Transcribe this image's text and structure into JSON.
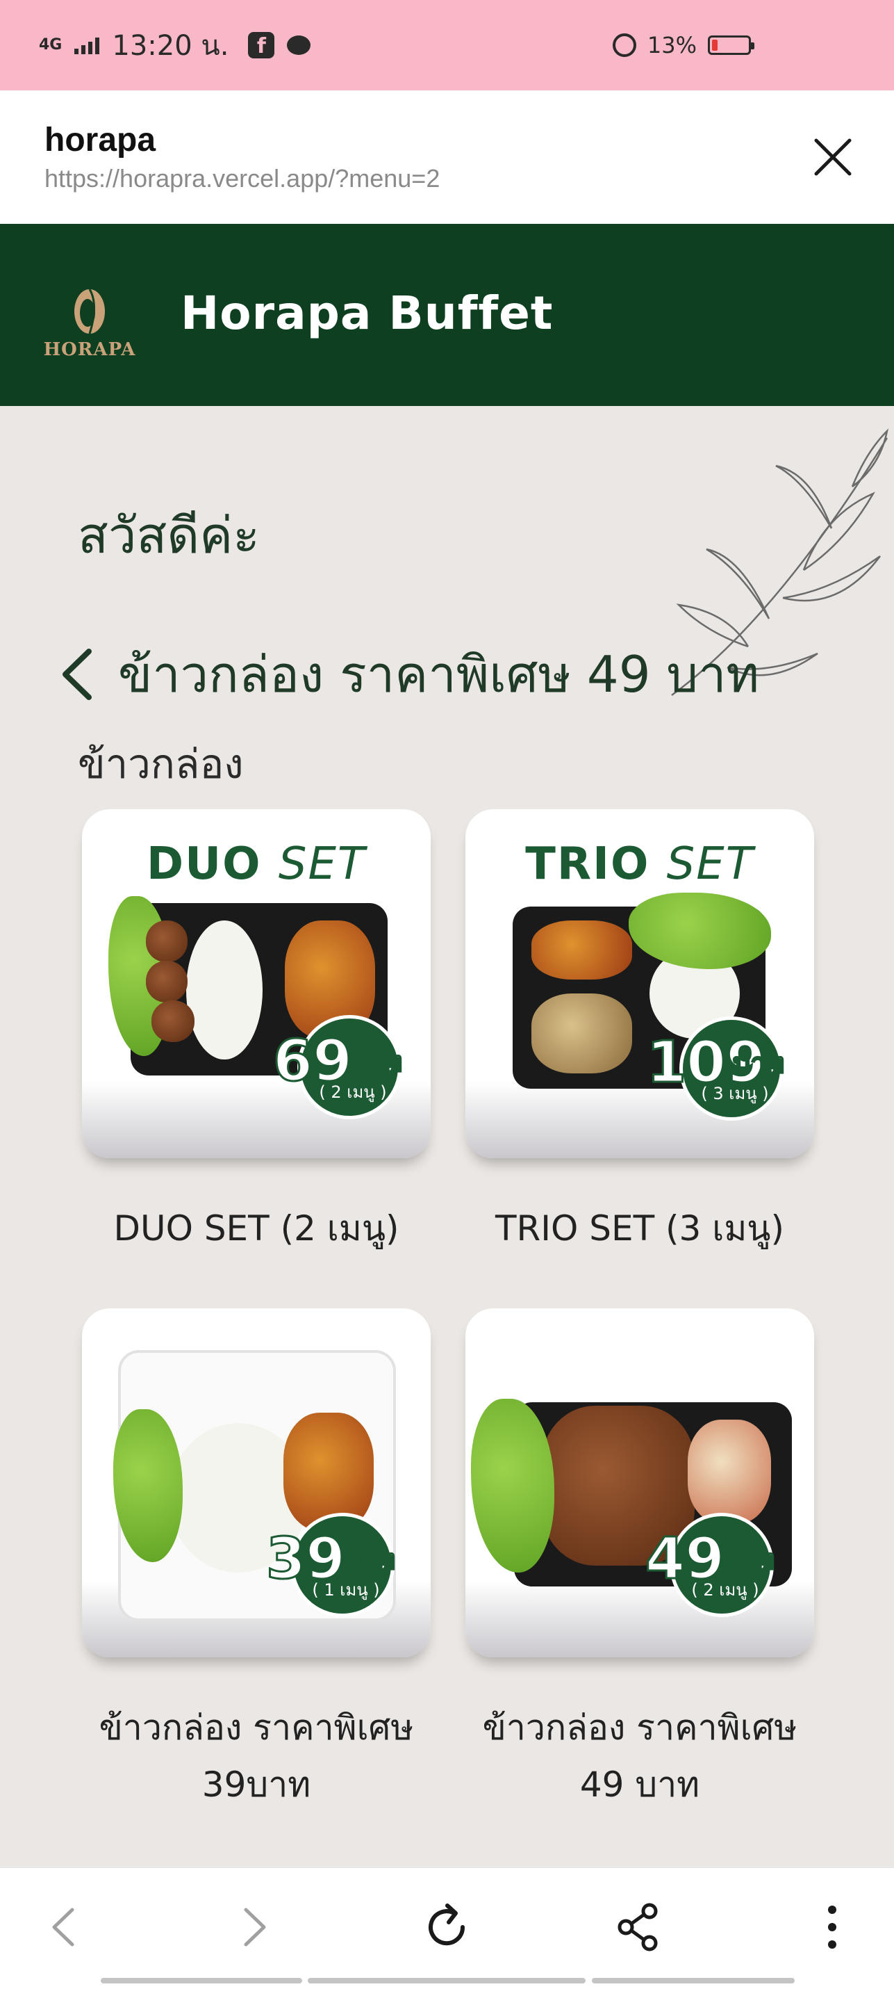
{
  "status_bar": {
    "network": "4G",
    "time": "13:20 น.",
    "battery": "13%",
    "facebook_glyph": "f"
  },
  "browser": {
    "title": "horapa",
    "url": "https://horapra.vercel.app/?menu=2"
  },
  "header": {
    "logo_text": "HORAPA",
    "title": "Horapa Buffet",
    "background": "#0e3f20"
  },
  "main": {
    "greeting": "สวัสดีค่ะ",
    "category_title": "ข้าวกล่อง ราคาพิเศษ 49 บาท",
    "section_label": "ข้าวกล่อง"
  },
  "products": [
    {
      "name": "DUO SET (2 เมนู)",
      "image_title_bold": "DUO",
      "image_title_light": "SET",
      "price": "69",
      "unit": "บาท",
      "menu_count": "( 2 เมนู )"
    },
    {
      "name": "TRIO SET (3 เมนู)",
      "image_title_bold": "TRIO",
      "image_title_light": "SET",
      "price": "109",
      "unit": "บาท",
      "menu_count": "( 3 เมนู )"
    },
    {
      "name_line1": "ข้าวกล่อง ราคาพิเศษ",
      "name_line2": "39บาท",
      "price": "39",
      "unit": "บาท",
      "menu_count": "( 1 เมนู )"
    },
    {
      "name_line1": "ข้าวกล่อง ราคาพิเศษ",
      "name_line2": "49 บาท",
      "price": "49",
      "unit": "บาท",
      "menu_count": "( 2 เมนู )"
    }
  ],
  "bottom_nav": [
    "back-icon",
    "forward-icon",
    "reload-icon",
    "share-icon",
    "more-icon"
  ],
  "colors": {
    "brand_green": "#1b5a32",
    "page_bg": "#ebe7e4",
    "status_bar": "#f8b8c7"
  }
}
